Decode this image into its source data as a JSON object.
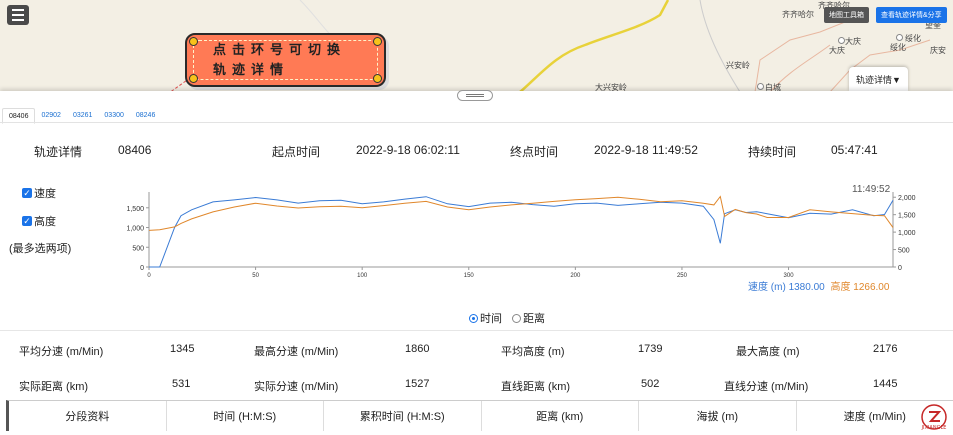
{
  "map": {
    "labels": [
      "齐齐哈尔",
      "齐齐哈尔",
      "大庆",
      "大庆",
      "绥化",
      "绥化",
      "望奎",
      "庆安",
      "兴安岭",
      "白城",
      "大兴安岭"
    ],
    "tools_button": "地图工具箱",
    "share_button": "查看轨迹详情&分享",
    "track_tab": "轨迹详情▼"
  },
  "tooltip": {
    "line1": "点击环号可切换",
    "line2": "轨迹详情"
  },
  "tabs": [
    "08406",
    "02902",
    "03261",
    "03300",
    "08246"
  ],
  "info": {
    "title": "轨迹详情",
    "ring": "08406",
    "start_label": "起点时间",
    "start_value": "2022-9-18 06:02:11",
    "end_label": "终点时间",
    "end_value": "2022-9-18 11:49:52",
    "duration_label": "持续时间",
    "duration_value": "05:47:41"
  },
  "toggles": {
    "speed": "速度",
    "altitude": "高度",
    "note": "(最多选两项)"
  },
  "radios": {
    "time": "时间",
    "distance": "距离",
    "selected": "time"
  },
  "chart_data": {
    "type": "line",
    "x": [
      0,
      5,
      12,
      15,
      20,
      30,
      40,
      50,
      60,
      70,
      80,
      90,
      100,
      110,
      120,
      130,
      140,
      150,
      160,
      170,
      180,
      190,
      200,
      210,
      220,
      230,
      240,
      250,
      260,
      265,
      268,
      270,
      275,
      280,
      285,
      290,
      300,
      310,
      320,
      330,
      340,
      345,
      349
    ],
    "x_ticks": [
      0,
      50,
      100,
      150,
      200,
      250,
      300
    ],
    "xlim": [
      0,
      349
    ],
    "end_label": "11:49:52",
    "series": [
      {
        "name": "速度 (m)",
        "axis": "left",
        "color": "#3a7bd5",
        "values": [
          0,
          0,
          1000,
          1300,
          1450,
          1650,
          1700,
          1760,
          1700,
          1620,
          1680,
          1690,
          1600,
          1650,
          1720,
          1780,
          1600,
          1530,
          1620,
          1640,
          1580,
          1540,
          1600,
          1620,
          1560,
          1600,
          1640,
          1620,
          1540,
          1200,
          600,
          1350,
          1450,
          1380,
          1400,
          1350,
          1250,
          1360,
          1340,
          1450,
          1300,
          1330,
          1690
        ],
        "end_value": "1380.00"
      },
      {
        "name": "高度",
        "axis": "right",
        "color": "#e0872b",
        "values": [
          1050,
          1070,
          1150,
          1250,
          1380,
          1580,
          1720,
          1830,
          1750,
          1690,
          1730,
          1740,
          1700,
          1760,
          1830,
          1880,
          1720,
          1640,
          1720,
          1780,
          1830,
          1880,
          1930,
          1960,
          2000,
          1940,
          1870,
          1900,
          1830,
          1780,
          2020,
          1450,
          1650,
          1560,
          1520,
          1420,
          1420,
          1640,
          1580,
          1530,
          1480,
          1470,
          1130
        ],
        "end_value": "1266.00"
      }
    ],
    "left_axis": {
      "ticks": [
        "0",
        "500",
        "1,000",
        "1,500"
      ],
      "ylim": [
        0,
        1900
      ]
    },
    "right_axis": {
      "ticks": [
        "0",
        "500",
        "1,000",
        "1,500",
        "2,000"
      ],
      "ylim": [
        0,
        2150
      ]
    },
    "legend_position": "bottom-right"
  },
  "stats": [
    {
      "label": "平均分速 (m/Min)",
      "value": "1345"
    },
    {
      "label": "最高分速 (m/Min)",
      "value": "1860"
    },
    {
      "label": "平均高度 (m)",
      "value": "1739"
    },
    {
      "label": "最大高度 (m)",
      "value": "2176"
    },
    {
      "label": "实际距离 (km)",
      "value": "531"
    },
    {
      "label": "实际分速 (m/Min)",
      "value": "1527"
    },
    {
      "label": "直线距离 (km)",
      "value": "502"
    },
    {
      "label": "直线分速 (m/Min)",
      "value": "1445"
    }
  ],
  "segment_columns": [
    "分段资料",
    "时间 (H:M:S)",
    "累积时间 (H:M:S)",
    "距离 (km)",
    "海拔 (m)",
    "速度 (m/Min)"
  ],
  "logo": {
    "text": "JIXIANGLE",
    "subtext": "吉祥乐"
  },
  "colors": {
    "accent": "#1a73e8",
    "speed": "#3a7bd5",
    "altitude": "#e0872b",
    "tooltip": "#ff7a55"
  }
}
